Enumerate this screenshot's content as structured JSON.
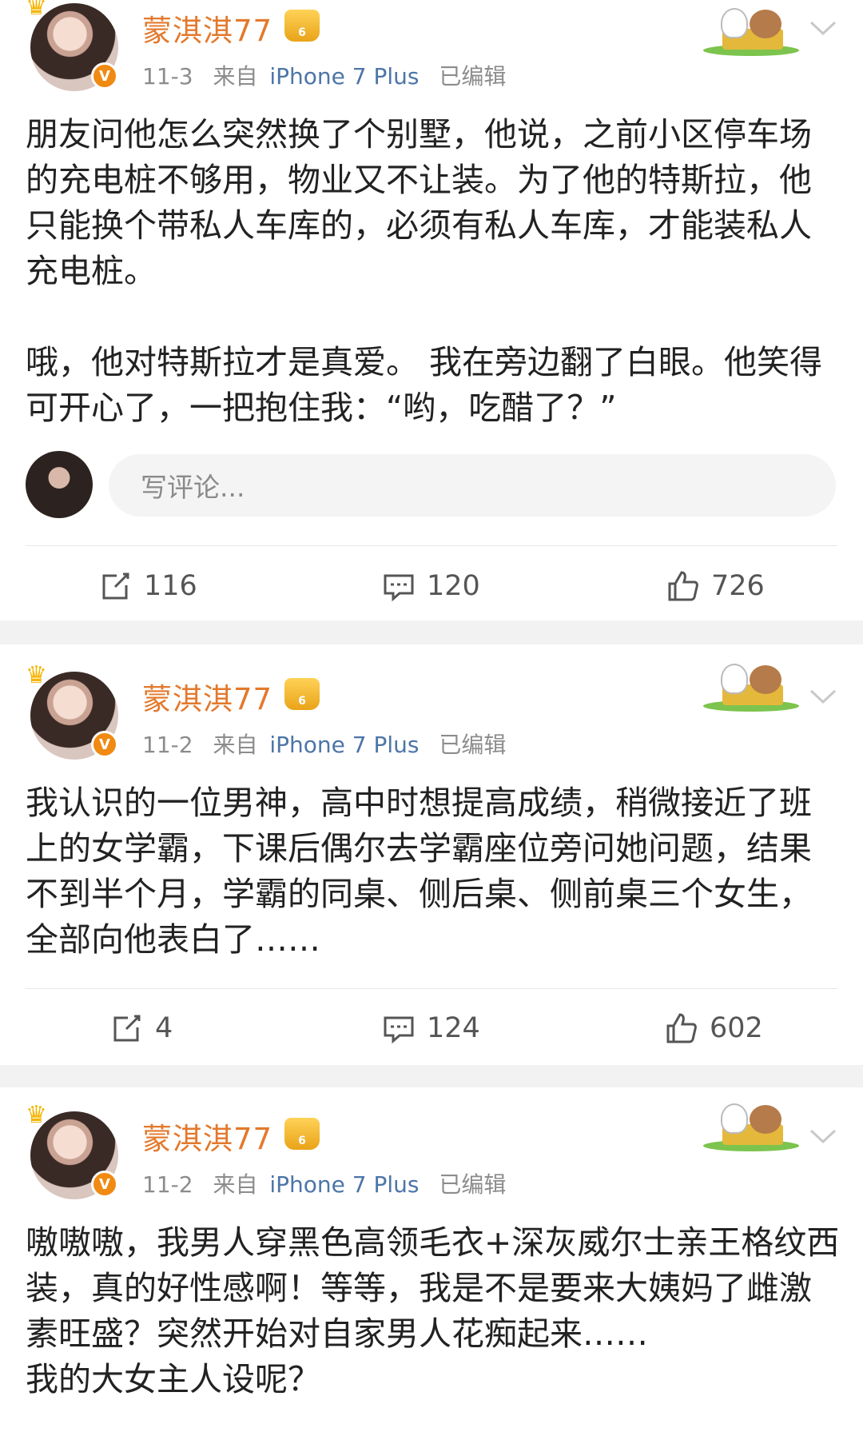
{
  "posts": [
    {
      "username": "蒙淇淇77",
      "vip_badge": "6",
      "verified_badge": "V",
      "date": "11-3",
      "source_prefix": "来自",
      "source": "iPhone 7 Plus",
      "edited": "已编辑",
      "content": "朋友问他怎么突然换了个别墅，他说，之前小区停车场的充电桩不够用，物业又不让装。为了他的特斯拉，他只能换个带私人车库的，必须有私人车库，才能装私人充电桩。\n\n哦，他对特斯拉才是真爱。 我在旁边翻了白眼。他笑得可开心了，一把抱住我：“哟，吃醋了？”",
      "comment_placeholder": "写评论...",
      "repost_count": "116",
      "comment_count": "120",
      "like_count": "726"
    },
    {
      "username": "蒙淇淇77",
      "vip_badge": "6",
      "verified_badge": "V",
      "date": "11-2",
      "source_prefix": "来自",
      "source": "iPhone 7 Plus",
      "edited": "已编辑",
      "content": "我认识的一位男神，高中时想提高成绩，稍微接近了班上的女学霸，下课后偶尔去学霸座位旁问她问题，结果不到半个月，学霸的同桌、侧后桌、侧前桌三个女生，全部向他表白了……",
      "repost_count": "4",
      "comment_count": "124",
      "like_count": "602"
    },
    {
      "username": "蒙淇淇77",
      "vip_badge": "6",
      "verified_badge": "V",
      "date": "11-2",
      "source_prefix": "来自",
      "source": "iPhone 7 Plus",
      "edited": "已编辑",
      "content": "嗷嗷嗷，我男人穿黑色高领毛衣+深灰威尔士亲王格纹西装，真的好性感啊！等等，我是不是要来大姨妈了雌激素旺盛？突然开始对自家男人花痴起来……\n我的大女主人设呢？"
    }
  ],
  "icons": {
    "repost": "repost-icon",
    "comment": "comment-icon",
    "like": "thumbs-up-icon",
    "more": "chevron-down-icon"
  },
  "colors": {
    "username": "#e3792c",
    "source_link": "#4d75a8",
    "meta": "#8c8c8c",
    "feed_background": "#f2f2f2"
  }
}
